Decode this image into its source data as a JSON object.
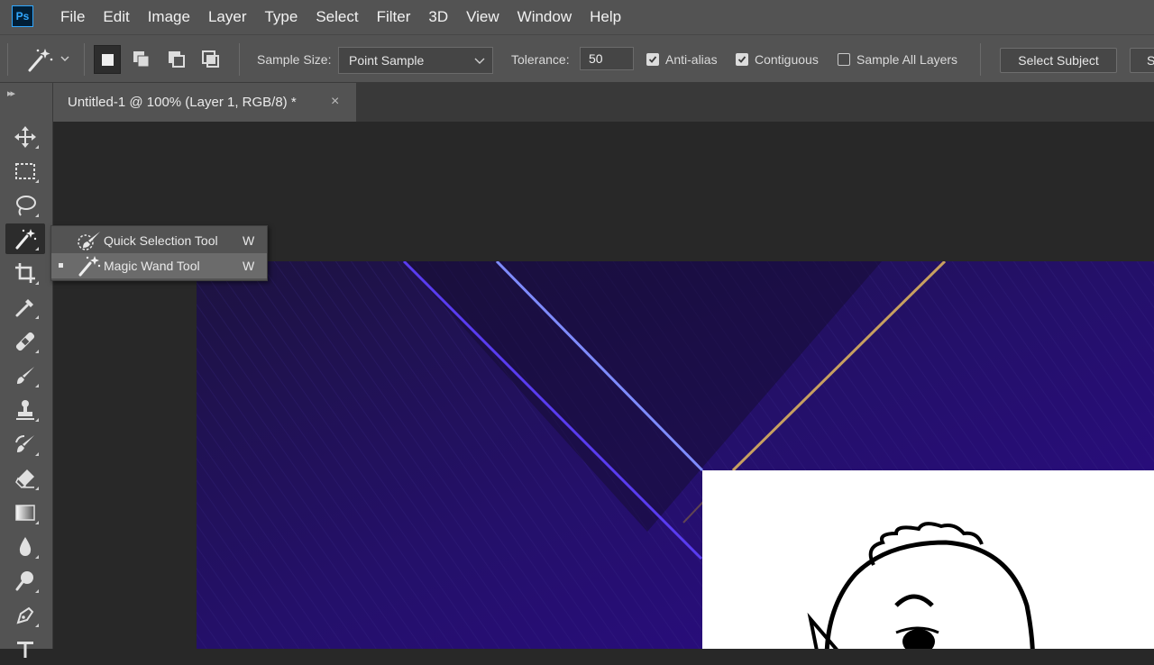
{
  "app": {
    "logo_text": "Ps"
  },
  "menu": [
    "File",
    "Edit",
    "Image",
    "Layer",
    "Type",
    "Select",
    "Filter",
    "3D",
    "View",
    "Window",
    "Help"
  ],
  "options": {
    "sample_size_label": "Sample Size:",
    "sample_size_value": "Point Sample",
    "tolerance_label": "Tolerance:",
    "tolerance_value": "50",
    "anti_alias_label": "Anti-alias",
    "anti_alias_checked": true,
    "contiguous_label": "Contiguous",
    "contiguous_checked": true,
    "sample_all_layers_label": "Sample All Layers",
    "sample_all_layers_checked": false,
    "select_subject_label": "Select Subject",
    "next_button_label": "S"
  },
  "document": {
    "tab_title": "Untitled-1 @ 100% (Layer 1, RGB/8) *",
    "close_glyph": "×"
  },
  "tools": [
    "move-icon",
    "rectangular-marquee-icon",
    "lasso-icon",
    "magic-wand-icon",
    "crop-icon",
    "eyedropper-icon",
    "healing-brush-icon",
    "brush-icon",
    "clone-stamp-icon",
    "history-brush-icon",
    "eraser-icon",
    "gradient-icon",
    "blur-icon",
    "dodge-icon",
    "pen-icon",
    "type-icon"
  ],
  "active_tool": "magic-wand-icon",
  "flyout": {
    "items": [
      {
        "label": "Quick Selection Tool",
        "shortcut": "W",
        "icon": "quick-selection-icon",
        "selected": false
      },
      {
        "label": "Magic Wand Tool",
        "shortcut": "W",
        "icon": "magic-wand-icon",
        "selected": true
      }
    ]
  },
  "colors": {
    "ui_panel": "#535353",
    "workspace": "#282828",
    "canvas_purple": "#1f0f5a",
    "accent_blue": "#31a8ff"
  }
}
